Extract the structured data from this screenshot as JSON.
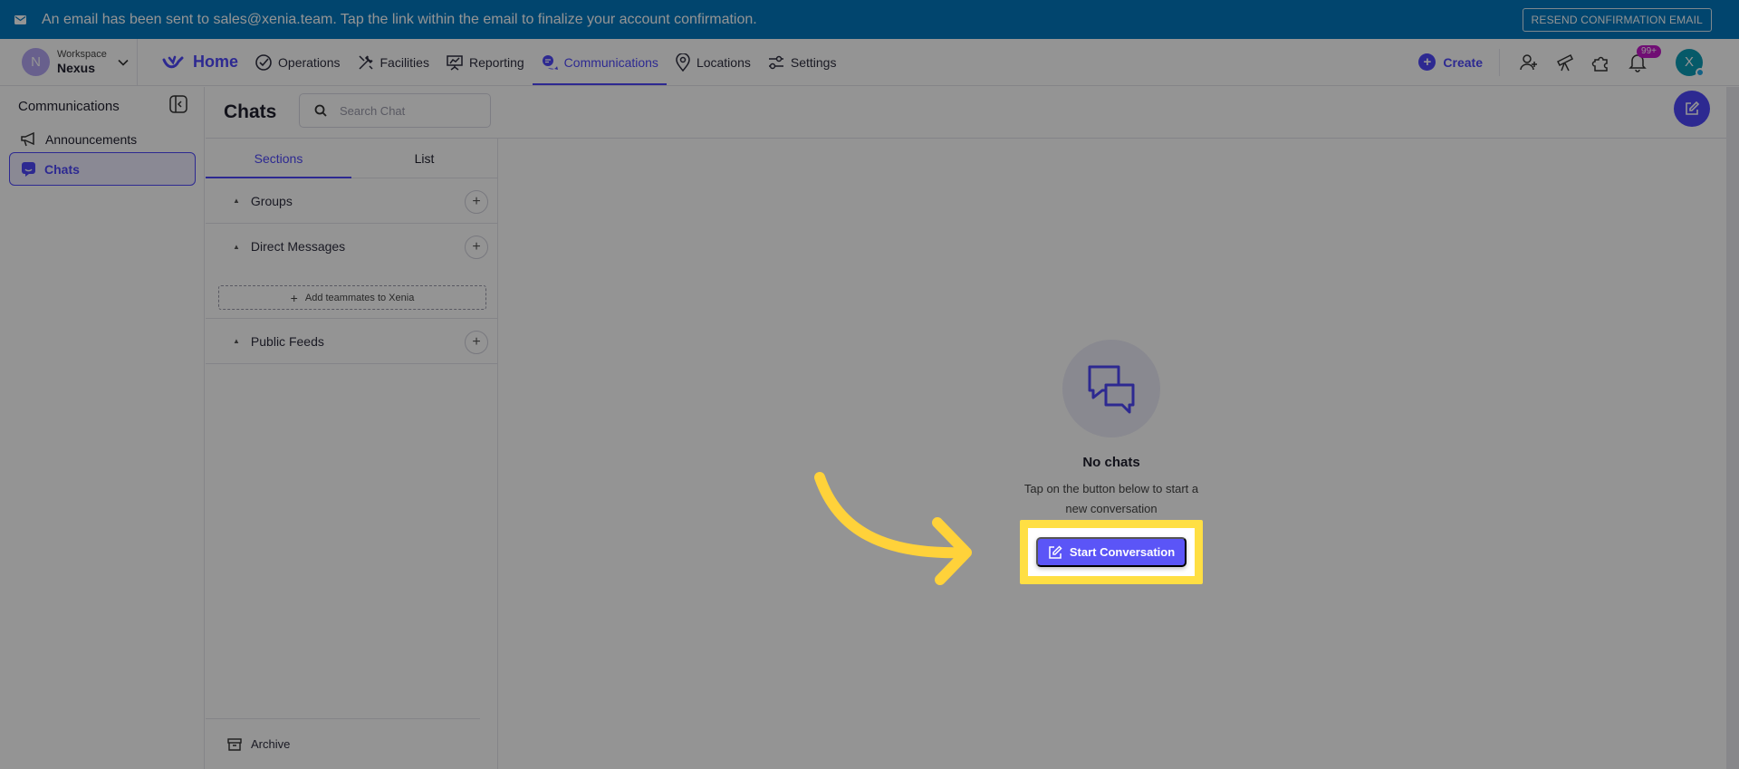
{
  "banner": {
    "message": "An email has been sent to sales@xenia.team. Tap the link within the email to finalize your account confirmation.",
    "resend_label": "RESEND CONFIRMATION EMAIL"
  },
  "workspace": {
    "label": "Workspace",
    "name": "Nexus",
    "initial": "N"
  },
  "nav": {
    "home": "Home",
    "items": [
      {
        "label": "Operations",
        "icon": "check-circle-icon"
      },
      {
        "label": "Facilities",
        "icon": "tools-icon"
      },
      {
        "label": "Reporting",
        "icon": "presentation-chart-icon"
      },
      {
        "label": "Communications",
        "icon": "chat-bubbles-icon"
      },
      {
        "label": "Locations",
        "icon": "location-pin-icon"
      },
      {
        "label": "Settings",
        "icon": "sliders-icon"
      }
    ],
    "create_label": "Create",
    "notifications_badge": "99+",
    "user_initial": "X"
  },
  "sidebar": {
    "title": "Communications",
    "items": [
      {
        "label": "Announcements",
        "icon": "megaphone-icon"
      },
      {
        "label": "Chats",
        "icon": "chat-icon"
      }
    ]
  },
  "chats": {
    "title": "Chats",
    "search_placeholder": "Search Chat"
  },
  "panel": {
    "tabs": [
      "Sections",
      "List"
    ],
    "sections": {
      "groups": "Groups",
      "direct_messages": "Direct Messages",
      "public_feeds": "Public Feeds"
    },
    "add_teammates": "Add teammates to Xenia",
    "archive": "Archive"
  },
  "empty_state": {
    "title": "No chats",
    "subtitle": "Tap on the button below to start a new conversation",
    "button": "Start Conversation"
  },
  "colors": {
    "accent": "#4e48fa",
    "banner": "#0277bd",
    "highlight": "#ffdf43"
  }
}
